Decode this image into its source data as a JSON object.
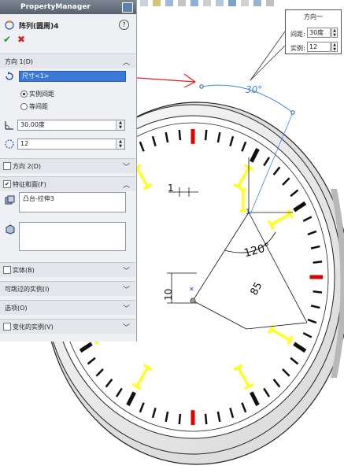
{
  "panel": {
    "title": "PropertyManager",
    "feature_name": "阵列(圆周)4"
  },
  "direction1": {
    "header": "方向 1(D)",
    "reference": "尺寸<1>",
    "option_instance_spacing": "实例间距",
    "option_equal_spacing": "等间距",
    "angle": "30.00度",
    "count": "12"
  },
  "direction2": {
    "header": "方向 2(D)"
  },
  "features_faces": {
    "header": "特征和面(F)",
    "features_list": [
      "凸台-拉伸3"
    ]
  },
  "collapsed_groups": [
    "实体(B)",
    "可跳过的实例(I)",
    "选项(O)",
    "变化的实例(V)"
  ],
  "direction_dialog": {
    "title": "方向一",
    "spacing_label": "间距:",
    "spacing_value": "30度",
    "count_label": "实例:",
    "count_value": "12"
  },
  "drawing": {
    "angle_preview": "30°",
    "dim_rotation": "120°",
    "dim_radius": "85",
    "dim_height": "10",
    "dim_width": "1"
  },
  "colors": {
    "red_annotation": "#e02020",
    "marker_yellow": "#ffff22",
    "dim_blue": "#3a86d8",
    "red_marker": "#e00000"
  }
}
